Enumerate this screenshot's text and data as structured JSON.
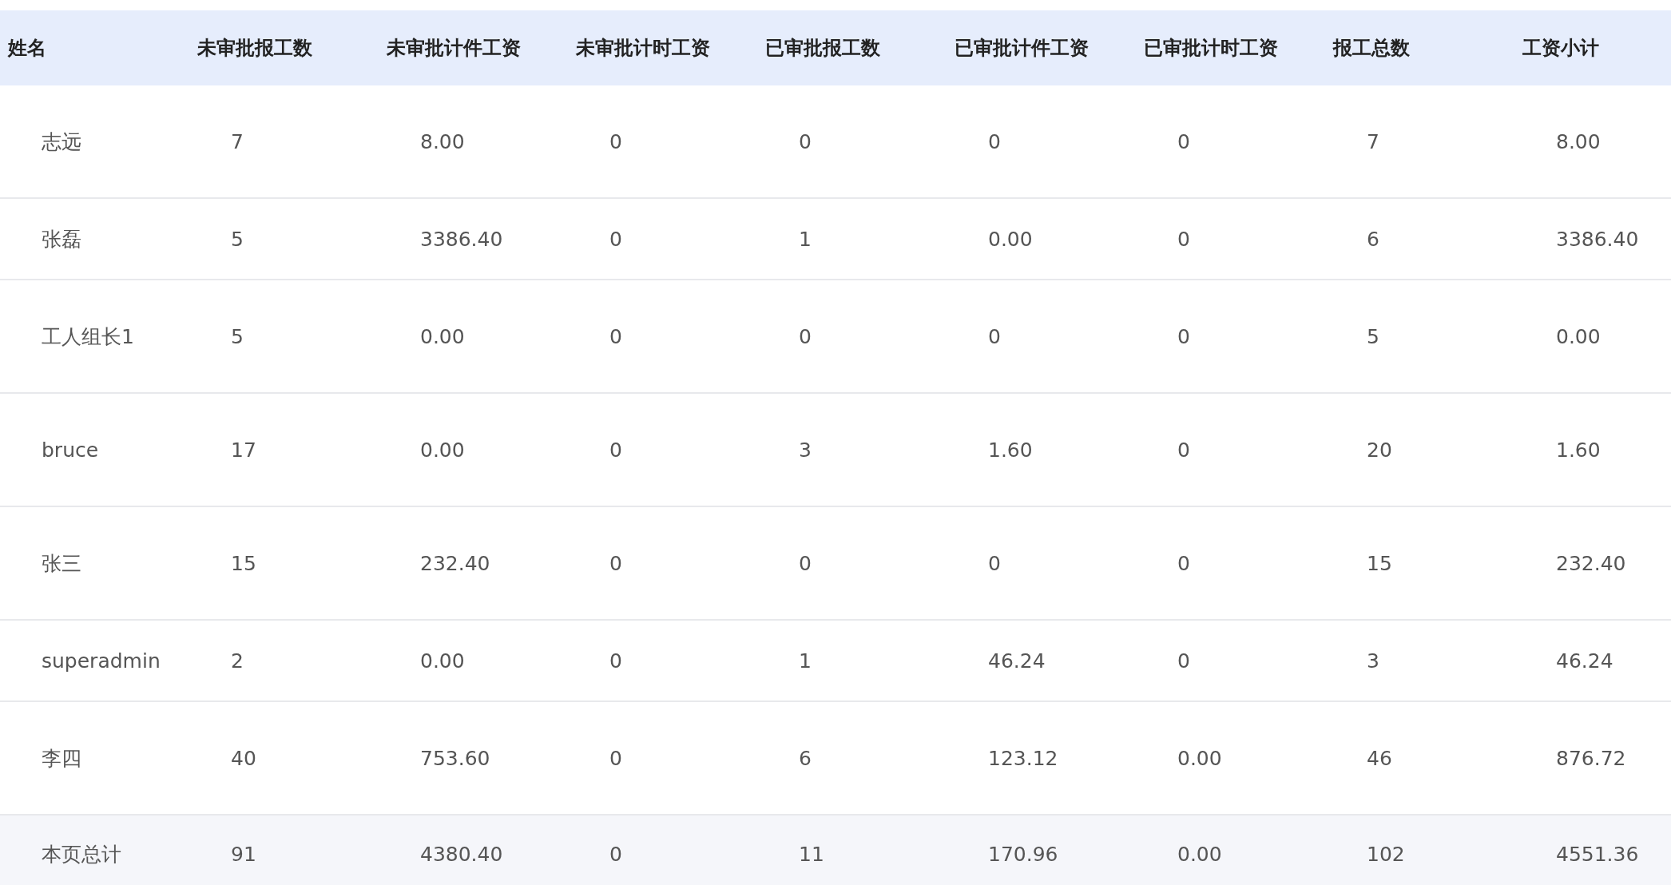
{
  "table": {
    "columns": [
      "姓名",
      "未审批报工数",
      "未审批计件工资",
      "未审批计时工资",
      "已审批报工数",
      "已审批计件工资",
      "已审批计时工资",
      "报工总数",
      "工资小计"
    ],
    "rows": [
      [
        "志远",
        "7",
        "8.00",
        "0",
        "0",
        "0",
        "0",
        "7",
        "8.00"
      ],
      [
        "张磊",
        "5",
        "3386.40",
        "0",
        "1",
        "0.00",
        "0",
        "6",
        "3386.40"
      ],
      [
        "工人组长1",
        "5",
        "0.00",
        "0",
        "0",
        "0",
        "0",
        "5",
        "0.00"
      ],
      [
        "bruce",
        "17",
        "0.00",
        "0",
        "3",
        "1.60",
        "0",
        "20",
        "1.60"
      ],
      [
        "张三",
        "15",
        "232.40",
        "0",
        "0",
        "0",
        "0",
        "15",
        "232.40"
      ],
      [
        "superadmin",
        "2",
        "0.00",
        "0",
        "1",
        "46.24",
        "0",
        "3",
        "46.24"
      ],
      [
        "李四",
        "40",
        "753.60",
        "0",
        "6",
        "123.12",
        "0.00",
        "46",
        "876.72"
      ]
    ],
    "summary": [
      "本页总计",
      "91",
      "4380.40",
      "0",
      "11",
      "170.96",
      "0.00",
      "102",
      "4551.36"
    ]
  }
}
